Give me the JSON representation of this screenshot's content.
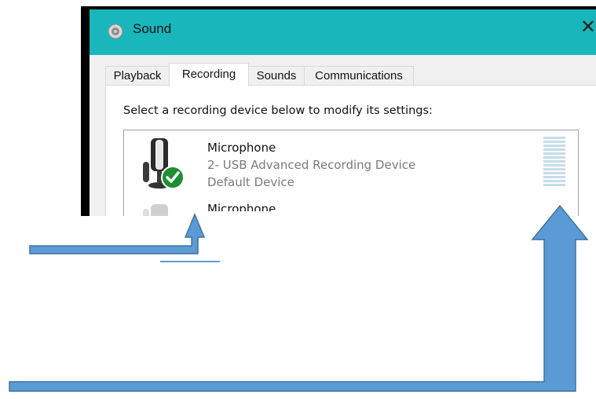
{
  "window": {
    "title": "Sound",
    "close_glyph": "✕"
  },
  "tabs": [
    {
      "label": "Playback",
      "active": false
    },
    {
      "label": "Recording",
      "active": true
    },
    {
      "label": "Sounds",
      "active": false
    },
    {
      "label": "Communications",
      "active": false
    }
  ],
  "panel": {
    "instruction": "Select a recording device below to modify its settings:"
  },
  "devices": [
    {
      "name": "Microphone",
      "description": "2- USB Advanced Recording Device",
      "status": "Default Device",
      "icon": "microphone-icon",
      "badge": "default-check-icon",
      "level": 0
    },
    {
      "name": "Microphone",
      "icon": "microphone-icon"
    }
  ],
  "colors": {
    "titlebar": "#19b6bc",
    "arrow_fill": "#5b9bd5",
    "arrow_stroke": "#41719c",
    "check_badge": "#1d8f2f",
    "meter_bar": "#c6dceb"
  },
  "annotations": [
    {
      "type": "arrow",
      "points_to": "default-device-check-icon"
    },
    {
      "type": "arrow",
      "points_to": "level-meter"
    }
  ]
}
